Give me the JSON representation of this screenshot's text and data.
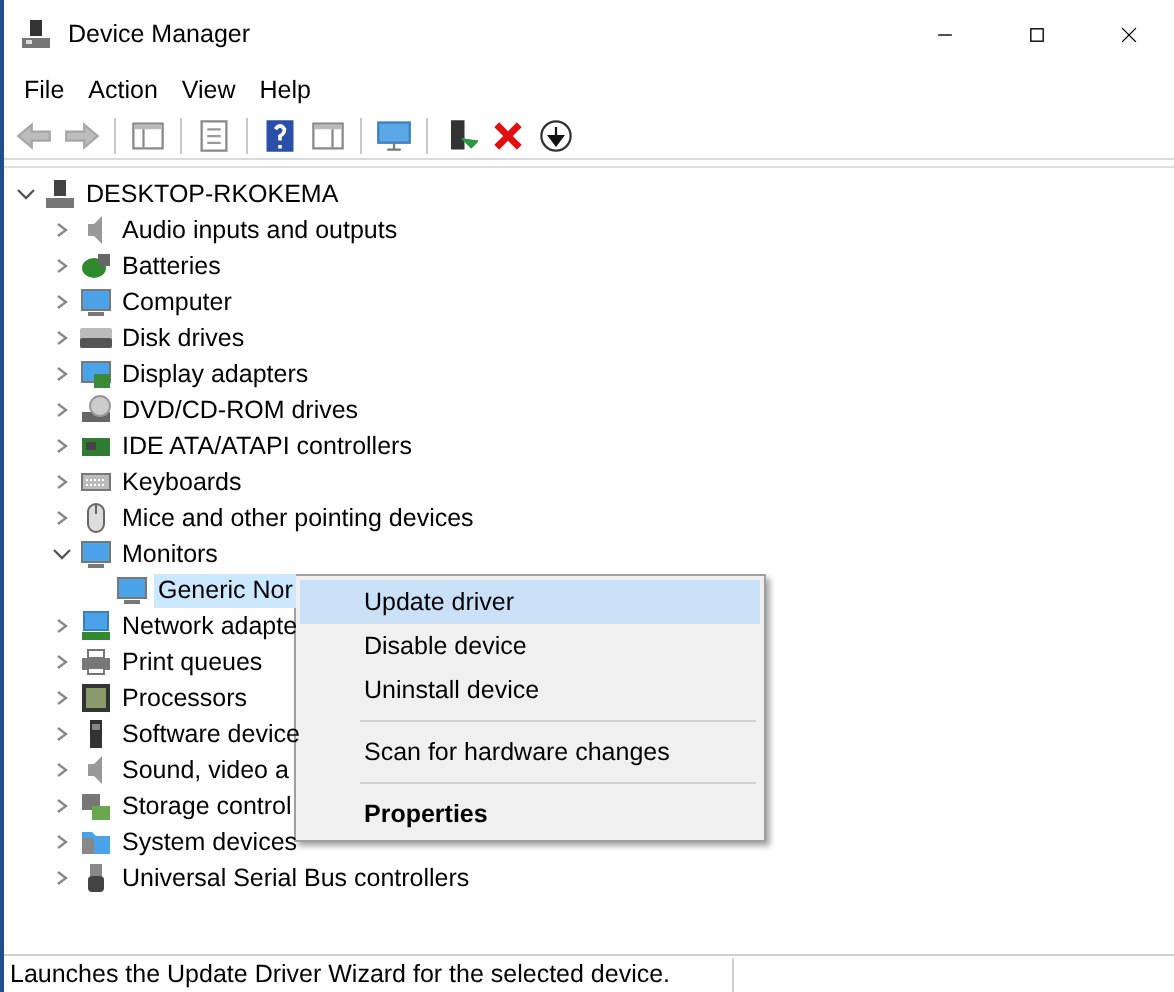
{
  "window": {
    "title": "Device Manager"
  },
  "menu_bar": [
    "File",
    "Action",
    "View",
    "Help"
  ],
  "toolbar": [
    {
      "kind": "back",
      "disabled": true
    },
    {
      "kind": "forward",
      "disabled": true
    },
    {
      "kind": "separator"
    },
    {
      "kind": "tree-pane"
    },
    {
      "kind": "separator"
    },
    {
      "kind": "properties"
    },
    {
      "kind": "separator"
    },
    {
      "kind": "help"
    },
    {
      "kind": "action-pane"
    },
    {
      "kind": "separator"
    },
    {
      "kind": "scan"
    },
    {
      "kind": "separator"
    },
    {
      "kind": "update"
    },
    {
      "kind": "uninstall"
    },
    {
      "kind": "disable"
    }
  ],
  "tree": {
    "label": "DESKTOP-RKOKEMA",
    "kind": "computer-node",
    "expanded": true,
    "children": [
      {
        "label": "Audio inputs and outputs",
        "kind": "speaker",
        "expanded": false
      },
      {
        "label": "Batteries",
        "kind": "battery",
        "expanded": false
      },
      {
        "label": "Computer",
        "kind": "monitor",
        "expanded": false
      },
      {
        "label": "Disk drives",
        "kind": "disk",
        "expanded": false
      },
      {
        "label": "Display adapters",
        "kind": "adapter",
        "expanded": false
      },
      {
        "label": "DVD/CD-ROM drives",
        "kind": "dvd",
        "expanded": false
      },
      {
        "label": "IDE ATA/ATAPI controllers",
        "kind": "card",
        "expanded": false
      },
      {
        "label": "Keyboards",
        "kind": "keyboard",
        "expanded": false
      },
      {
        "label": "Mice and other pointing devices",
        "kind": "mouse",
        "expanded": false
      },
      {
        "label": "Monitors",
        "kind": "monitor",
        "expanded": true,
        "children": [
          {
            "label": "Generic Nor",
            "kind": "monitor",
            "selected": true
          }
        ]
      },
      {
        "label": "Network adapte",
        "kind": "network",
        "expanded": false
      },
      {
        "label": "Print queues",
        "kind": "printer",
        "expanded": false
      },
      {
        "label": "Processors",
        "kind": "chip",
        "expanded": false
      },
      {
        "label": "Software device",
        "kind": "phone",
        "expanded": false
      },
      {
        "label": "Sound, video a",
        "kind": "speaker",
        "expanded": false
      },
      {
        "label": "Storage control",
        "kind": "storage",
        "expanded": false
      },
      {
        "label": "System devices",
        "kind": "folder",
        "expanded": false
      },
      {
        "label": "Universal Serial Bus controllers",
        "kind": "usb",
        "expanded": false
      }
    ]
  },
  "context_menu": [
    {
      "kind": "item",
      "label": "Update driver",
      "selected": true
    },
    {
      "kind": "item",
      "label": "Disable device",
      "selected": false
    },
    {
      "kind": "item",
      "label": "Uninstall device",
      "selected": false
    },
    {
      "kind": "separator"
    },
    {
      "kind": "item",
      "label": "Scan for hardware changes",
      "selected": false
    },
    {
      "kind": "separator"
    },
    {
      "kind": "item",
      "label": "Properties",
      "selected": false,
      "default": true
    }
  ],
  "status_bar": "Launches the Update Driver Wizard for the selected device."
}
